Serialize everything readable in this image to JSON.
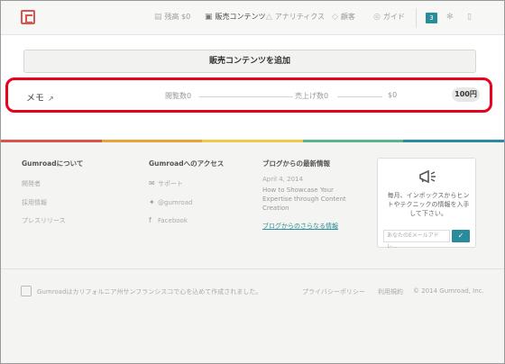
{
  "header": {
    "nav": [
      {
        "label": "残高 $0",
        "icon": "wallet-icon"
      },
      {
        "label": "販売コンテンツ",
        "icon": "package-icon",
        "active": true
      },
      {
        "label": "アナリティクス",
        "icon": "chart-icon"
      },
      {
        "label": "顧客",
        "icon": "tag-icon"
      },
      {
        "label": "ガイド",
        "icon": "compass-icon"
      }
    ],
    "notification_count": "3"
  },
  "main": {
    "add_button_label": "販売コンテンツを追加",
    "product": {
      "name": "メモ",
      "views": "閲覧数0",
      "sales": "売上げ数0",
      "revenue": "$0",
      "price": "100円"
    }
  },
  "footer": {
    "about": {
      "title": "Gumroadについて",
      "links": [
        "開発者",
        "採用情報",
        "プレスリリース"
      ]
    },
    "access": {
      "title": "Gumroadへのアクセス",
      "links": [
        "サポート",
        "@gumroad",
        "Facebook"
      ]
    },
    "blog": {
      "title": "ブログからの最新情報",
      "date": "April 4, 2014",
      "post": "How to Showcase Your Expertise through Content Creation",
      "more_link": "ブログからのさらなる情報"
    },
    "newsletter": {
      "text": "毎月、インボックスからヒントやテクニックの情報を入手して下さい。",
      "placeholder": "あなたのEメールアドレ..."
    },
    "bottom": {
      "made_in": "Gumroadはカリフォルニア州サンフランシスコで心を込めて作成されました。",
      "privacy": "プライバシーポリシー",
      "terms": "利用規約",
      "copyright": "© 2014 Gumroad, Inc."
    }
  },
  "colors": {
    "accent": "#2a8c9a",
    "highlight_border": "#e8001c",
    "stripe": [
      "#d9534f",
      "#e8a33d",
      "#f0c84a",
      "#5ab38c",
      "#2a8c9a"
    ]
  }
}
